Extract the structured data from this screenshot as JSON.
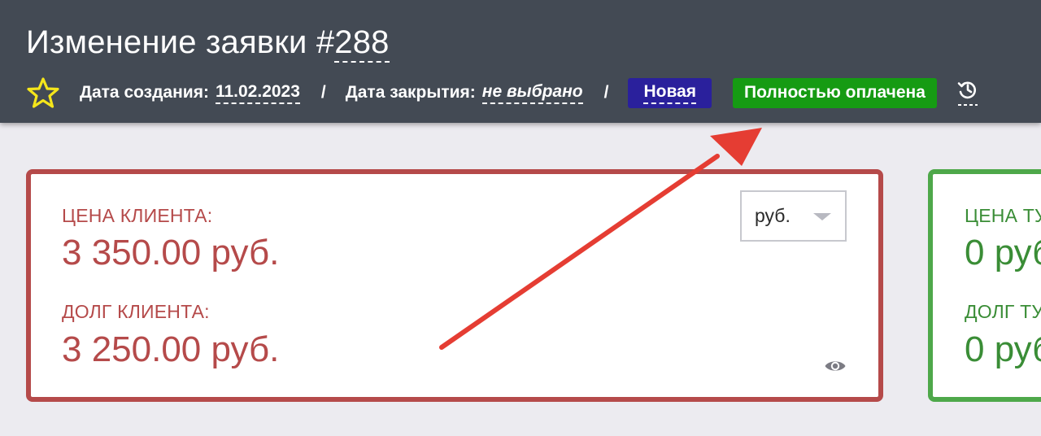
{
  "header": {
    "title": "Изменение заявки #",
    "order_number": "288",
    "created_label": "Дата создания:",
    "created_value": "11.02.2023",
    "separator": "/",
    "closed_label": "Дата закрытия:",
    "closed_value": "не выбрано",
    "status_badge": "Новая",
    "payment_badge": "Полностью оплачена"
  },
  "client_card": {
    "price_label": "ЦЕНА КЛИЕНТА:",
    "price_value": "3 350.00 руб.",
    "debt_label": "ДОЛГ КЛИЕНТА:",
    "debt_value": "3 250.00 руб.",
    "currency_selected": "руб."
  },
  "tour_card": {
    "price_label": "ЦЕНА ТУ",
    "price_value": "0 руб",
    "debt_label": "ДОЛГ ТУ",
    "debt_value": "0 руб"
  },
  "icons": [
    "star-icon",
    "history-icon",
    "eye-icon",
    "chevron-down-icon"
  ],
  "colors": {
    "header_bg": "#434a54",
    "status_new": "#2a209c",
    "status_paid": "#169b13",
    "client_accent": "#b54a4a",
    "tour_accent": "#3a8d36",
    "annotation_arrow": "#e53d33",
    "star": "#f5e61b"
  }
}
